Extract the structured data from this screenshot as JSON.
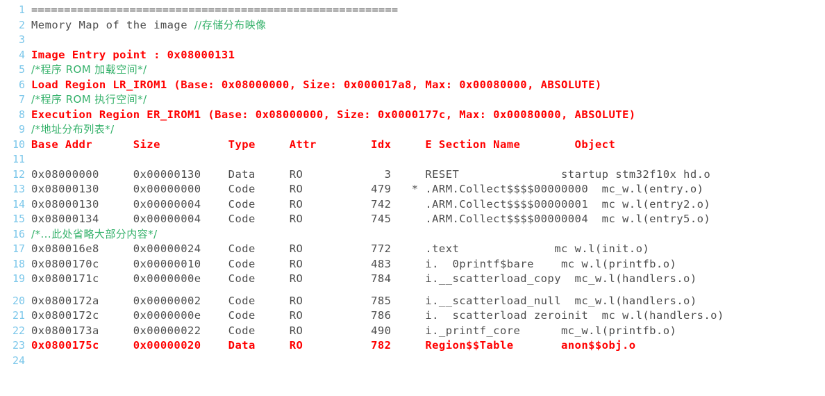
{
  "document": {
    "title": "Memory Map of the image listing",
    "kind": "code-listing",
    "colors": {
      "background": "#ffffff",
      "line_number": "#7cc7ea",
      "plain_text": "#4d4d4d",
      "highlight_red": "#ff0000",
      "comment_green": "#34b16a"
    }
  },
  "lines": [
    {
      "n": "1",
      "gap": false,
      "segments": [
        {
          "text": "========================================================",
          "style": "sep"
        }
      ]
    },
    {
      "n": "2",
      "gap": false,
      "segments": [
        {
          "text": "Memory Map of the image ",
          "style": "plain"
        },
        {
          "text": "//存储分布映像",
          "style": "green-cjk"
        }
      ]
    },
    {
      "n": "3",
      "gap": false,
      "segments": [
        {
          "text": "",
          "style": "plain"
        }
      ]
    },
    {
      "n": "4",
      "gap": false,
      "segments": [
        {
          "text": "Image Entry point : 0x08000131",
          "style": "red"
        }
      ]
    },
    {
      "n": "5",
      "gap": false,
      "segments": [
        {
          "text": "/*程序 ROM 加载空间*/",
          "style": "green-cjk"
        }
      ]
    },
    {
      "n": "6",
      "gap": false,
      "segments": [
        {
          "text": "Load Region LR_IROM1 (Base: 0x08000000, Size: 0x000017a8, Max: 0x00080000, ABSOLUTE)",
          "style": "red"
        }
      ]
    },
    {
      "n": "7",
      "gap": false,
      "segments": [
        {
          "text": "/*程序 ROM 执行空间*/",
          "style": "green-cjk"
        }
      ]
    },
    {
      "n": "8",
      "gap": false,
      "segments": [
        {
          "text": "Execution Region ER_IROM1 (Base: 0x08000000, Size: 0x0000177c, Max: 0x00080000, ABSOLUTE)",
          "style": "red"
        }
      ]
    },
    {
      "n": "9",
      "gap": false,
      "segments": [
        {
          "text": "/*地址分布列表*/",
          "style": "green-cjk"
        }
      ]
    },
    {
      "n": "10",
      "gap": false,
      "segments": [
        {
          "text": "Base Addr      Size          Type     Attr        Idx     E Section Name        Object",
          "style": "red"
        }
      ]
    },
    {
      "n": "11",
      "gap": false,
      "segments": [
        {
          "text": "",
          "style": "plain"
        }
      ]
    },
    {
      "n": "12",
      "gap": false,
      "segments": [
        {
          "text": "0x08000000     0x00000130    Data     RO            3     RESET               startup stm32f10x hd.o",
          "style": "plain"
        }
      ]
    },
    {
      "n": "13",
      "gap": false,
      "segments": [
        {
          "text": "0x08000130     0x00000000    Code     RO          479   * .ARM.Collect$$$$00000000  mc_w.l(entry.o)",
          "style": "plain"
        }
      ]
    },
    {
      "n": "14",
      "gap": false,
      "segments": [
        {
          "text": "0x08000130     0x00000004    Code     RO          742     .ARM.Collect$$$$00000001  mc w.l(entry2.o)",
          "style": "plain"
        }
      ]
    },
    {
      "n": "15",
      "gap": false,
      "segments": [
        {
          "text": "0x08000134     0x00000004    Code     RO          745     .ARM.Collect$$$$00000004  mc w.l(entry5.o)",
          "style": "plain"
        }
      ]
    },
    {
      "n": "16",
      "gap": false,
      "segments": [
        {
          "text": "/*...此处省略大部分内容*/",
          "style": "green-cjk"
        }
      ]
    },
    {
      "n": "17",
      "gap": false,
      "segments": [
        {
          "text": "0x080016e8     0x00000024    Code     RO          772     .text              mc w.l(init.o)",
          "style": "plain"
        }
      ]
    },
    {
      "n": "18",
      "gap": false,
      "segments": [
        {
          "text": "0x0800170c     0x00000010    Code     RO          483     i.  0printf$bare    mc w.l(printfb.o)",
          "style": "plain"
        }
      ]
    },
    {
      "n": "19",
      "gap": false,
      "segments": [
        {
          "text": "0x0800171c     0x0000000e    Code     RO          784     i.__scatterload_copy  mc_w.l(handlers.o)",
          "style": "plain"
        }
      ]
    },
    {
      "n": "20",
      "gap": true,
      "segments": [
        {
          "text": "0x0800172a     0x00000002    Code     RO          785     i.__scatterload_null  mc_w.l(handlers.o)",
          "style": "plain"
        }
      ]
    },
    {
      "n": "21",
      "gap": false,
      "segments": [
        {
          "text": "0x0800172c     0x0000000e    Code     RO          786     i.  scatterload zeroinit  mc w.l(handlers.o)",
          "style": "plain"
        }
      ]
    },
    {
      "n": "22",
      "gap": false,
      "segments": [
        {
          "text": "0x0800173a     0x00000022    Code     RO          490     i._printf_core      mc_w.l(printfb.o)",
          "style": "plain"
        }
      ]
    },
    {
      "n": "23",
      "gap": false,
      "segments": [
        {
          "text": "0x0800175c     0x00000020    Data     RO          782     Region$$Table       anon$$obj.o",
          "style": "red"
        }
      ]
    },
    {
      "n": "24",
      "gap": false,
      "segments": [
        {
          "text": "",
          "style": "plain"
        }
      ]
    }
  ]
}
